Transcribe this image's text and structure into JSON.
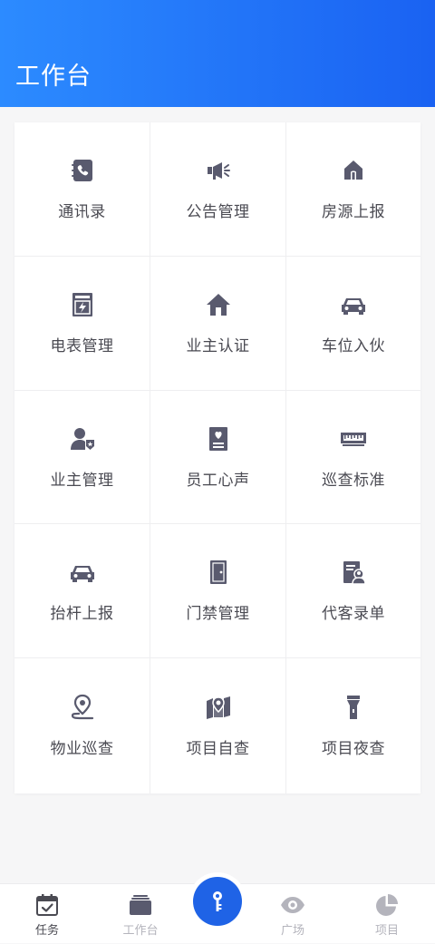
{
  "header": {
    "title": "工作台"
  },
  "grid": {
    "items": [
      {
        "label": "通讯录",
        "icon": "contacts-phone-icon"
      },
      {
        "label": "公告管理",
        "icon": "megaphone-icon"
      },
      {
        "label": "房源上报",
        "icon": "house-icon"
      },
      {
        "label": "电表管理",
        "icon": "electric-meter-icon"
      },
      {
        "label": "业主认证",
        "icon": "home-icon"
      },
      {
        "label": "车位入伙",
        "icon": "car-icon"
      },
      {
        "label": "业主管理",
        "icon": "user-badge-icon"
      },
      {
        "label": "员工心声",
        "icon": "heart-document-icon"
      },
      {
        "label": "巡查标准",
        "icon": "ruler-icon"
      },
      {
        "label": "抬杆上报",
        "icon": "car-icon"
      },
      {
        "label": "门禁管理",
        "icon": "door-icon"
      },
      {
        "label": "代客录单",
        "icon": "user-document-icon"
      },
      {
        "label": "物业巡查",
        "icon": "location-pin-icon"
      },
      {
        "label": "项目自查",
        "icon": "map-pin-icon"
      },
      {
        "label": "项目夜查",
        "icon": "flashlight-icon"
      }
    ]
  },
  "tabbar": {
    "items": [
      {
        "label": "任务",
        "icon": "calendar-check-icon",
        "active": true
      },
      {
        "label": "工作台",
        "icon": "card-stack-icon",
        "active": false
      },
      {
        "label": "广场",
        "icon": "eye-icon",
        "active": false
      },
      {
        "label": "项目",
        "icon": "pie-chart-icon",
        "active": false
      }
    ],
    "center_icon": "key-icon"
  },
  "colors": {
    "header_gradient_start": "#2c8bff",
    "header_gradient_end": "#1a62f2",
    "icon_color": "#595a6e",
    "tab_active": "#4a4a52",
    "tab_inactive": "#b4b4bc",
    "center_button": "#1f63e6"
  }
}
